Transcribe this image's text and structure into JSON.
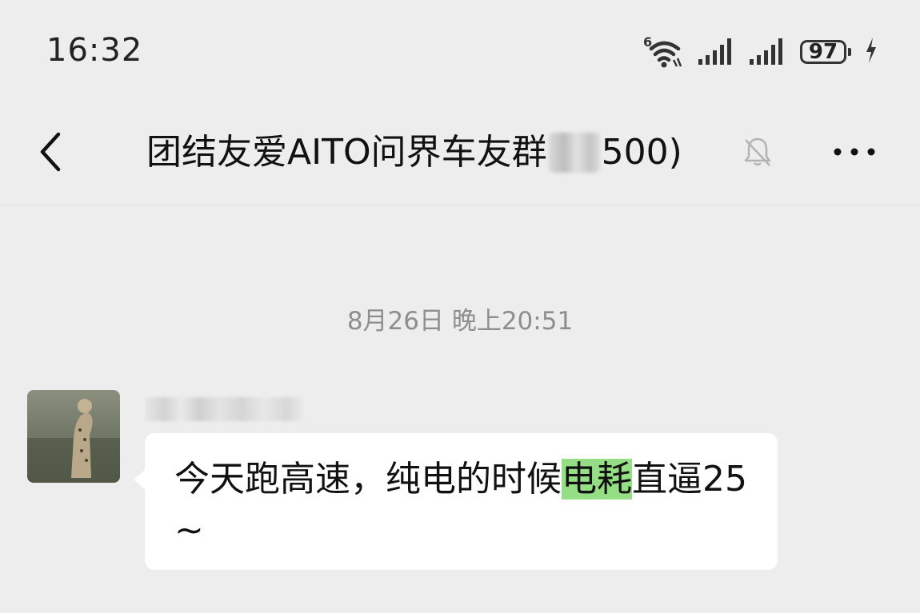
{
  "status_bar": {
    "time": "16:32",
    "wifi_badge": "6",
    "battery_level": "97",
    "icons": [
      "wifi-icon",
      "signal-icon",
      "signal-icon",
      "battery-icon",
      "charging-icon"
    ]
  },
  "header": {
    "title_prefix": "团结友爱AITO问界车友群",
    "title_suffix": "500)",
    "icons": [
      "back-icon",
      "mute-bell-icon",
      "more-icon"
    ]
  },
  "chat": {
    "timestamp": "8月26日 晚上20:51",
    "message": {
      "text_before": "今天跑高速，纯电的时候",
      "text_highlight": "电耗",
      "text_after": "直逼25 ~",
      "highlight_color": "#95de86"
    }
  },
  "colors": {
    "background": "#ededed",
    "bubble": "#ffffff",
    "timestamp": "#8e8e8e"
  }
}
